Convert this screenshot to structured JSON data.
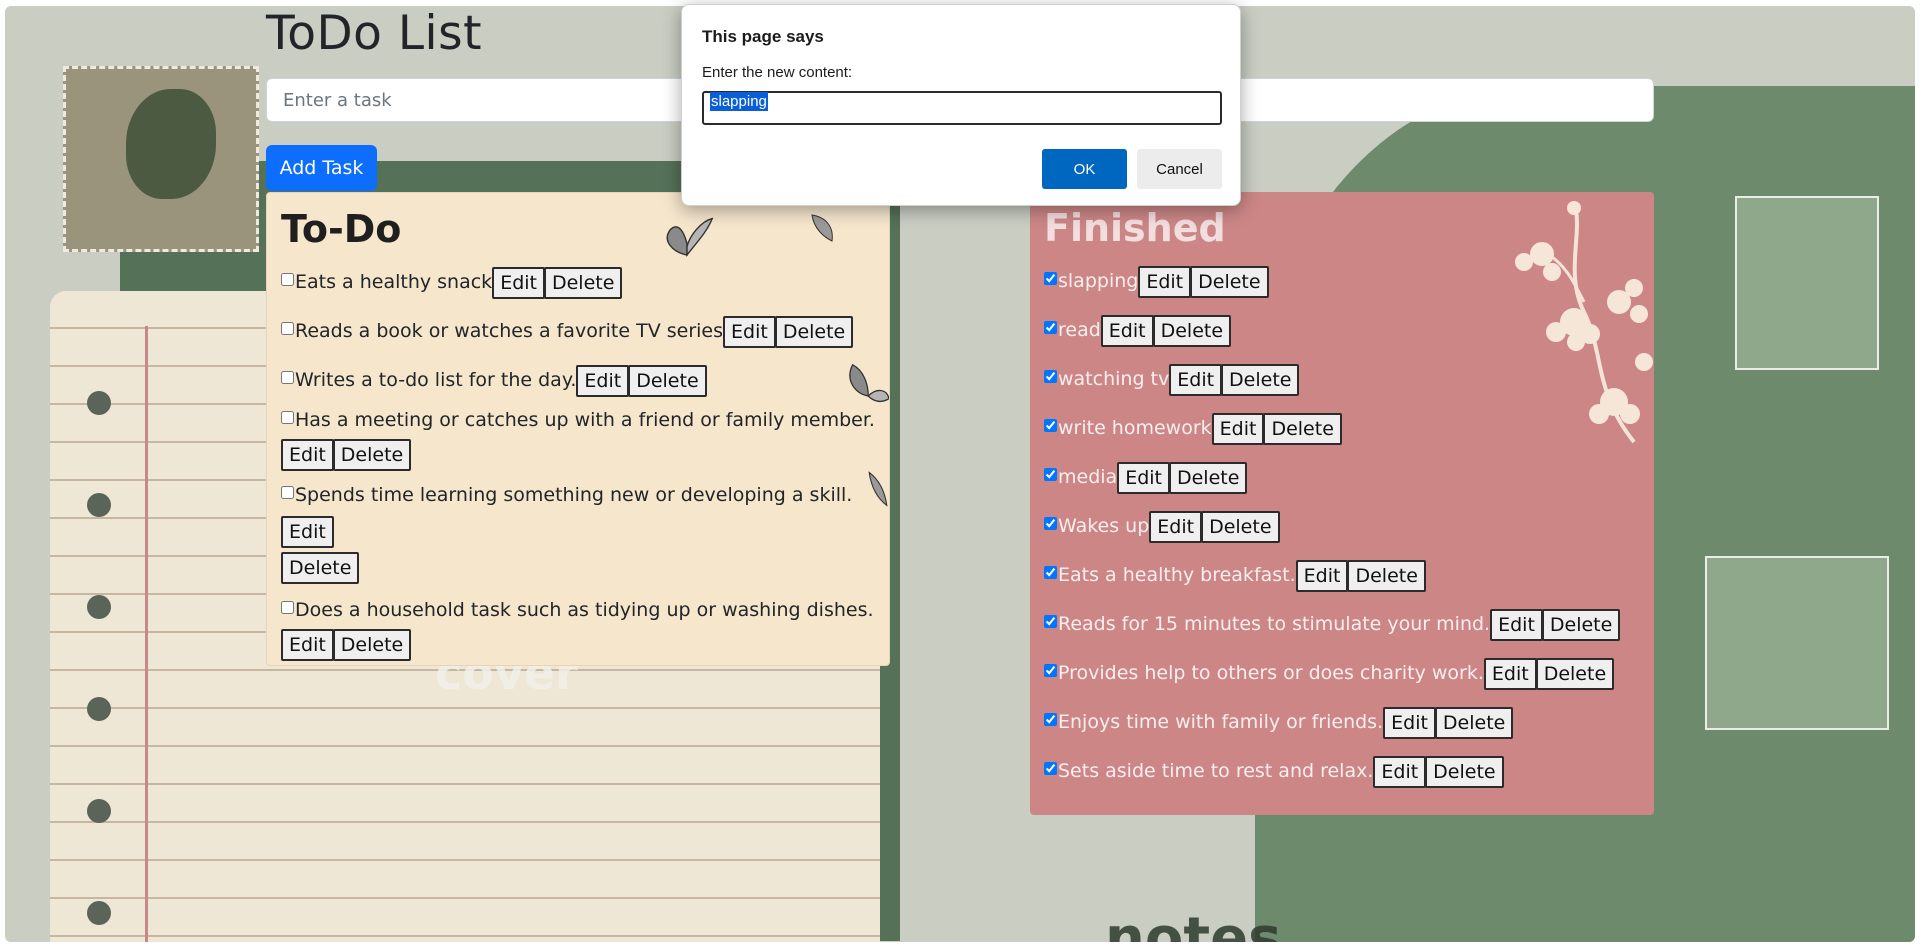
{
  "header": {
    "title": "ToDo List"
  },
  "task_input": {
    "placeholder": "Enter a task",
    "value": ""
  },
  "add_button": {
    "label": "Add Task"
  },
  "todo": {
    "heading": "To-Do",
    "items": [
      {
        "text": "Eats a healthy snack",
        "checked": false
      },
      {
        "text": "Reads a book or watches a favorite TV series",
        "checked": false
      },
      {
        "text": "Writes a to-do list for the day.",
        "checked": false
      },
      {
        "text": "Has a meeting or catches up with a friend or family member.",
        "checked": false
      },
      {
        "text": "Spends time learning something new or developing a skill.",
        "checked": false
      },
      {
        "text": "Does a household task such as tidying up or washing dishes.",
        "checked": false
      }
    ]
  },
  "finished": {
    "heading": "Finished",
    "items": [
      {
        "text": "slapping",
        "checked": true
      },
      {
        "text": "read",
        "checked": true
      },
      {
        "text": "watching tv",
        "checked": true
      },
      {
        "text": "write homework",
        "checked": true
      },
      {
        "text": "media",
        "checked": true
      },
      {
        "text": "Wakes up",
        "checked": true
      },
      {
        "text": "Eats a healthy breakfast.",
        "checked": true
      },
      {
        "text": "Reads for 15 minutes to stimulate your mind.",
        "checked": true
      },
      {
        "text": "Provides help to others or does charity work.",
        "checked": true
      },
      {
        "text": "Enjoys time with family or friends.",
        "checked": true
      },
      {
        "text": "Sets aside time to rest and relax.",
        "checked": true
      }
    ]
  },
  "item_buttons": {
    "edit": "Edit",
    "delete": "Delete"
  },
  "dialog": {
    "title": "This page says",
    "message": "Enter the new content:",
    "value": "slapping",
    "ok": "OK",
    "cancel": "Cancel"
  },
  "background_words": {
    "cover": "cover",
    "notes": "notes"
  },
  "colors": {
    "accent": "#0d6efd",
    "todo_panel": "#f5e6cc",
    "finished_panel": "#cc8686",
    "dialog_ok": "#0067c0"
  }
}
